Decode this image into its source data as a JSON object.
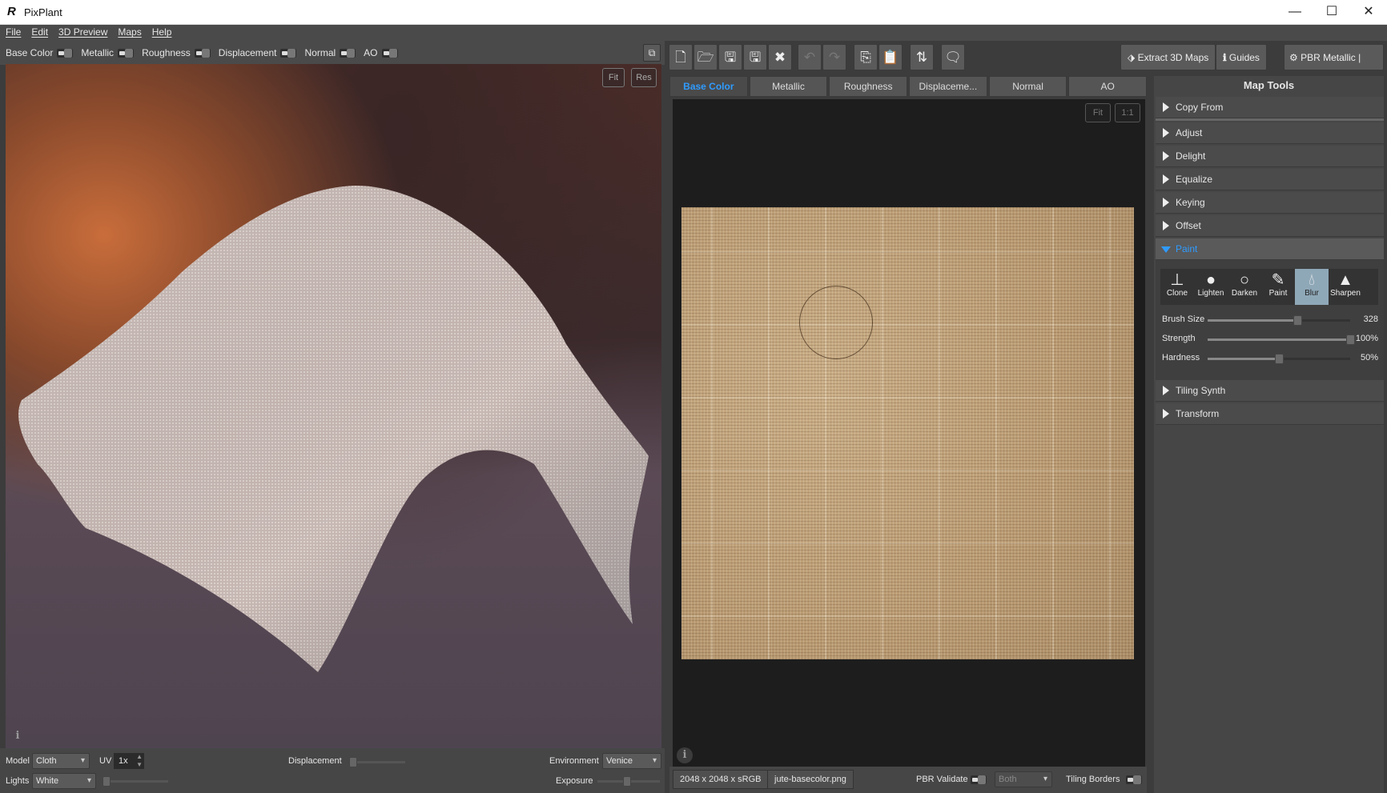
{
  "app": {
    "title": "PixPlant"
  },
  "window_controls": {
    "minimize": "—",
    "maximize": "☐",
    "close": "✕"
  },
  "menu": [
    "File",
    "Edit",
    "3D Preview",
    "Maps",
    "Help"
  ],
  "map_toggles": [
    "Base Color",
    "Metallic",
    "Roughness",
    "Displacement",
    "Normal",
    "AO"
  ],
  "viewport": {
    "fit": "Fit",
    "res": "Res",
    "info": "i"
  },
  "toolbar": {
    "extract": "Extract 3D Maps",
    "guides": "Guides",
    "pbr_mode": "PBR Metallic | H+V"
  },
  "tabs": [
    "Base Color",
    "Metallic",
    "Roughness",
    "Displaceme...",
    "Normal",
    "AO"
  ],
  "map_view": {
    "fit": "Fit",
    "one_to_one": "1:1",
    "info": "i"
  },
  "map_tools": {
    "title": "Map Tools",
    "sections": [
      "Copy From",
      "Adjust",
      "Delight",
      "Equalize",
      "Keying",
      "Offset",
      "Paint",
      "Tiling Synth",
      "Transform"
    ],
    "paint_tools": [
      "Clone",
      "Lighten",
      "Darken",
      "Paint",
      "Blur",
      "Sharpen"
    ],
    "active_tool": "Blur",
    "sliders": [
      {
        "label": "Brush Size",
        "value": "328",
        "fraction": 0.63
      },
      {
        "label": "Strength",
        "value": "100%",
        "fraction": 1.0
      },
      {
        "label": "Hardness",
        "value": "50%",
        "fraction": 0.5
      }
    ]
  },
  "bottom_left": {
    "model_label": "Model",
    "model": "Cloth",
    "uv_label": "UV",
    "uv": "1x",
    "displacement_label": "Displacement",
    "environment_label": "Environment",
    "environment": "Venice",
    "lights_label": "Lights",
    "lights": "White",
    "exposure_label": "Exposure"
  },
  "status": {
    "resolution": "2048 x 2048 x sRGB",
    "filename": "jute-basecolor.png",
    "pbr_validate": "PBR Validate",
    "pbr_mode": "Both",
    "tiling_borders": "Tiling Borders"
  }
}
